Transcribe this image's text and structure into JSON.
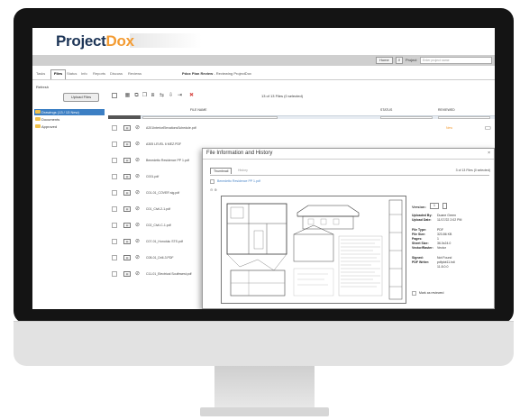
{
  "app": {
    "logo_project": "Project",
    "logo_dox": "Do",
    "logo_x": "x"
  },
  "topbar": {
    "home": "Home",
    "project_label": "Project",
    "project_placeholder": "Enter project name"
  },
  "tabs": [
    {
      "label": "Tasks"
    },
    {
      "label": "Files"
    },
    {
      "label": "Status"
    },
    {
      "label": "Info"
    },
    {
      "label": "Reports"
    },
    {
      "label": "Discuss"
    },
    {
      "label": "Reviews"
    }
  ],
  "page": {
    "title": "Pdox Plan Review",
    "subtitle": " - Reviewing ProjectDox"
  },
  "refresh": "Refresh",
  "upload": "Upload Files",
  "sidebar": {
    "folders": [
      {
        "label": "Drawings (13 / 13 New)"
      },
      {
        "label": "Documents"
      },
      {
        "label": "Approved"
      }
    ]
  },
  "toolbar": {
    "info": "13 of 13 Files (0 selected)"
  },
  "columns": {
    "file_name": "FILE NAME",
    "status": "STATUS",
    "reviewed": "REVIEWED"
  },
  "files": [
    {
      "name": "A201InteriorElevationsSchedule.pdf",
      "status": "New"
    },
    {
      "name": "A305 LEVEL 6 MEZ.PDF",
      "status": ""
    },
    {
      "name": "Benedetto Residence PP 1.pdf",
      "status": ""
    },
    {
      "name": "C001.pdf",
      "status": ""
    },
    {
      "name": "C01-01_COVER sig.pdf",
      "status": ""
    },
    {
      "name": "C01_Civil-2-1.pdf",
      "status": ""
    },
    {
      "name": "C02_Civil-C-1.pdf",
      "status": ""
    },
    {
      "name": "C07-01_Honolulu STS.pdf",
      "status": ""
    },
    {
      "name": "C08-01_Drill-3.PDF",
      "status": ""
    },
    {
      "name": "C11-01_Electrical Southwest.pdf",
      "status": ""
    }
  ],
  "modal": {
    "title": "File Information and History",
    "close": "×",
    "tab_thumbnail": "Thumbnail",
    "tab_history": "History",
    "count": "3 of 13 Files (0 selected)",
    "file": "Benedetto Residence PP 1.pdf",
    "version_label": "Version:",
    "version_value": "1",
    "meta": [
      {
        "k": "Uploaded By:",
        "v": "Duane Green"
      },
      {
        "k": "Upload Date:",
        "v": "11/17/22 2:02 PM"
      },
      {
        "k": "",
        "v": ""
      },
      {
        "k": "File Type:",
        "v": "PDF"
      },
      {
        "k": "File Size:",
        "v": "323.86 KB"
      },
      {
        "k": "Pages:",
        "v": "1"
      },
      {
        "k": "Sheet Size:",
        "v": "36.0x24.0"
      },
      {
        "k": "Vector/Raster:",
        "v": "Vector"
      },
      {
        "k": "",
        "v": ""
      },
      {
        "k": "Signed:",
        "v": "Not Found"
      },
      {
        "k": "PDF Writer:",
        "v": "pdfplot11.hdi"
      },
      {
        "k": "",
        "v": "11.8.0.0"
      }
    ],
    "mark_reviewed": "Mark as reviewed"
  },
  "colors": {
    "brand_dark": "#1d3557",
    "brand_orange": "#f39c34",
    "selected_blue": "#3c7fc4"
  }
}
